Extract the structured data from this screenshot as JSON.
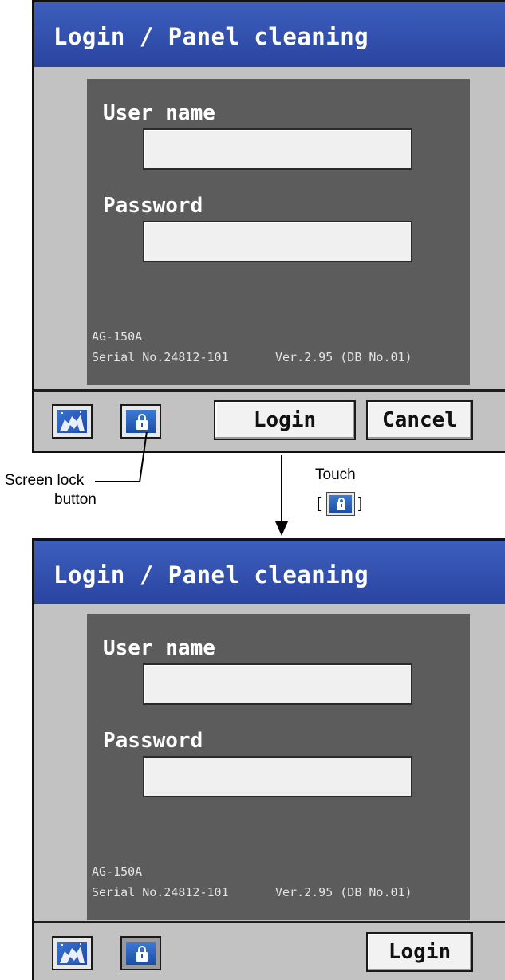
{
  "screens": [
    {
      "title": "Login / Panel cleaning",
      "user_label": "User name",
      "password_label": "Password",
      "user_value": "",
      "password_value": "",
      "model": "AG-150A",
      "serial": "Serial No.24812-101",
      "version": "Ver.2.95 (DB No.01)",
      "login_label": "Login",
      "cancel_label": "Cancel"
    },
    {
      "title": "Login / Panel cleaning",
      "user_label": "User name",
      "password_label": "Password",
      "user_value": "",
      "password_value": "",
      "model": "AG-150A",
      "serial": "Serial No.24812-101",
      "version": "Ver.2.95 (DB No.01)",
      "login_label": "Login"
    }
  ],
  "annotations": {
    "screen_lock_line1": "Screen lock",
    "screen_lock_line2": "button",
    "touch": "Touch",
    "bracket_open": "[",
    "bracket_close": "]"
  },
  "icons": {
    "cleaning": "panel-cleaning-icon",
    "lock": "lock-icon"
  },
  "colors": {
    "title_bar": "#3452b4",
    "panel": "#5c5c5c",
    "background": "#c2c2c2",
    "icon_blue": "#2a5fc0"
  }
}
